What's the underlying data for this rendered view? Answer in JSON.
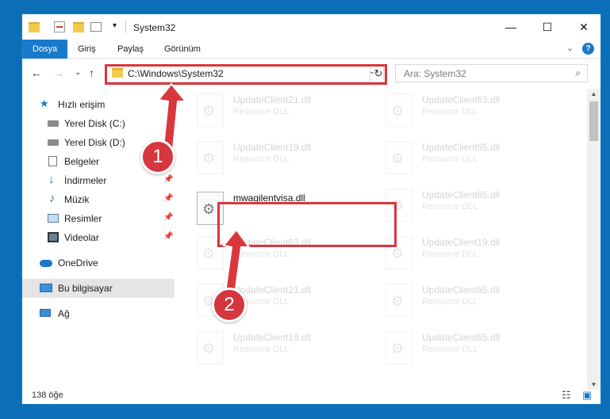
{
  "window": {
    "title": "System32",
    "min_glyph": "—",
    "max_glyph": "☐",
    "close_glyph": "✕"
  },
  "ribbon": {
    "tabs": [
      "Dosya",
      "Giriş",
      "Paylaş",
      "Görünüm"
    ],
    "expand_glyph": "⌄",
    "help_glyph": "?"
  },
  "nav": {
    "back_glyph": "←",
    "forward_glyph": "→",
    "recent_glyph": "⌄",
    "up_glyph": "↑",
    "address": "C:\\Windows\\System32",
    "address_dropdown_glyph": "⌄",
    "refresh_glyph": "↻",
    "search_placeholder": "Ara: System32",
    "search_icon": "⌕"
  },
  "sidebar": {
    "items": [
      {
        "label": "Hızlı erişim",
        "icon": "star-icon"
      },
      {
        "label": "Yerel Disk (C:)",
        "icon": "drive-icon",
        "pinned": true
      },
      {
        "label": "Yerel Disk (D:)",
        "icon": "drive-icon",
        "pinned": true
      },
      {
        "label": "Belgeler",
        "icon": "document-icon",
        "pinned": true
      },
      {
        "label": "İndirmeler",
        "icon": "download-icon",
        "pinned": true
      },
      {
        "label": "Müzik",
        "icon": "music-icon",
        "pinned": true
      },
      {
        "label": "Resimler",
        "icon": "picture-icon",
        "pinned": true
      },
      {
        "label": "Videolar",
        "icon": "video-icon",
        "pinned": true
      },
      {
        "label": "OneDrive",
        "icon": "cloud-icon"
      },
      {
        "label": "Bu bilgisayar",
        "icon": "computer-icon",
        "selected": true
      },
      {
        "label": "Ağ",
        "icon": "network-icon"
      }
    ],
    "pin_glyph": "📌"
  },
  "files": {
    "left_column": [
      {
        "name": "UpdateClient21.dll",
        "type": "Resource DLL"
      },
      {
        "name": "UpdateClient19.dll",
        "type": "Resource DLL"
      },
      {
        "name": "mwagilentvisa.dll",
        "type": ""
      },
      {
        "name": "UpdateClient63.dll",
        "type": "Resource DLL"
      },
      {
        "name": "UpdateClient21.dll",
        "type": "Resource DLL"
      },
      {
        "name": "UpdateClient19.dll",
        "type": "Resource DLL"
      }
    ],
    "right_column": [
      {
        "name": "UpdateClient63.dll",
        "type": "Resource DLL"
      },
      {
        "name": "UpdateClient65.dll",
        "type": "Resource DLL"
      },
      {
        "name": "UpdateClient65.dll",
        "type": "Resource DLL"
      },
      {
        "name": "UpdateClient19.dll",
        "type": "Resource DLL"
      },
      {
        "name": "UpdateClient65.dll",
        "type": "Resource DLL"
      },
      {
        "name": "UpdateClient65.dll",
        "type": "Resource DLL"
      }
    ],
    "gear_glyph": "⚙"
  },
  "status": {
    "item_count": "138 öğe",
    "details_view_glyph": "☷",
    "large_icons_glyph": "▣"
  },
  "annotations": {
    "step1": "1",
    "step2": "2",
    "highlight_color": "#d9373c"
  }
}
